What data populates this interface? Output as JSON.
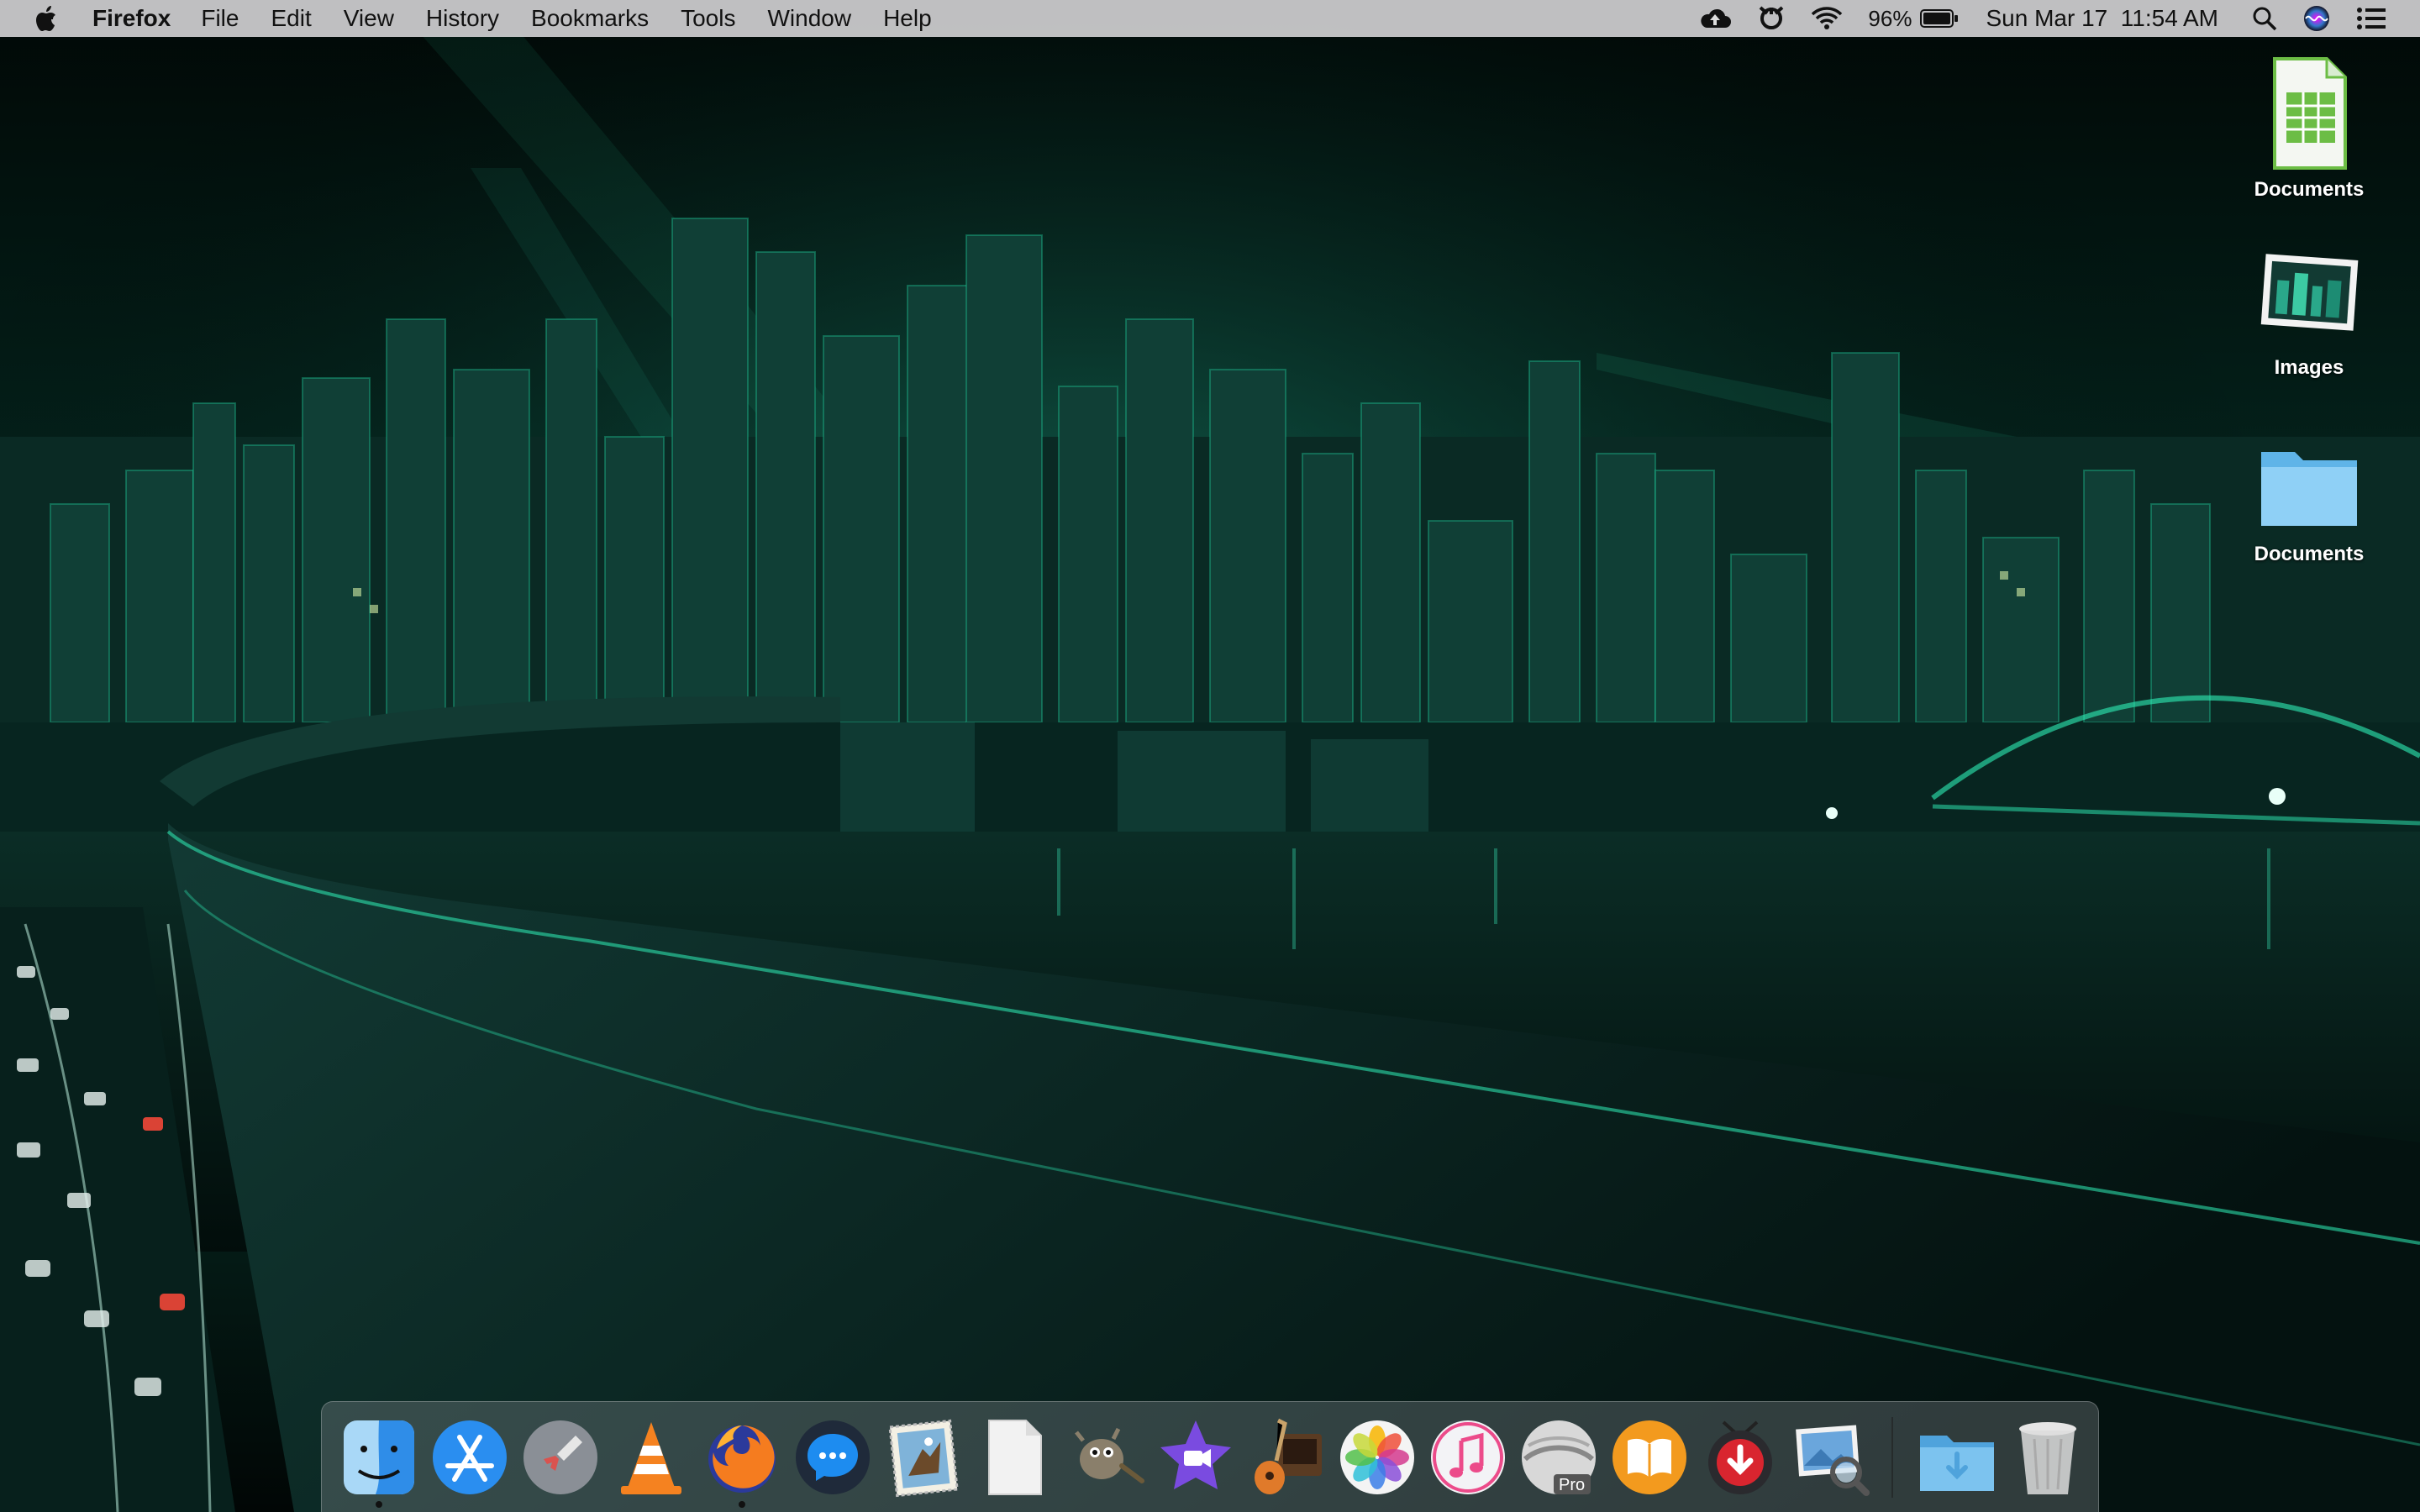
{
  "menubar": {
    "app_name": "Firefox",
    "menus": [
      "File",
      "Edit",
      "View",
      "History",
      "Bookmarks",
      "Tools",
      "Window",
      "Help"
    ],
    "battery_percent": "96%",
    "datetime": "Sun Mar 17  11:54 AM",
    "status_icons": [
      "apple-icon",
      "cloud-upload-icon",
      "avast-icon",
      "wifi-icon",
      "battery-icon",
      "spotlight-search-icon",
      "siri-icon",
      "notification-center-icon"
    ]
  },
  "desktop": {
    "icons": [
      {
        "label": "Documents",
        "icon": "spreadsheet-file-icon"
      },
      {
        "label": "Images",
        "icon": "image-file-icon"
      },
      {
        "label": "Documents",
        "icon": "folder-icon"
      }
    ]
  },
  "dock": {
    "apps": [
      {
        "name": "Finder",
        "icon": "finder-icon",
        "running": true
      },
      {
        "name": "App Store",
        "icon": "app-store-icon",
        "running": false
      },
      {
        "name": "Launchpad",
        "icon": "launchpad-icon",
        "running": false
      },
      {
        "name": "VLC",
        "icon": "vlc-icon",
        "running": false
      },
      {
        "name": "Firefox",
        "icon": "firefox-icon",
        "running": true
      },
      {
        "name": "Messenger",
        "icon": "messenger-icon",
        "running": false
      },
      {
        "name": "Mail",
        "icon": "mail-stamp-icon",
        "running": false
      },
      {
        "name": "TextEdit",
        "icon": "blank-document-icon",
        "running": false
      },
      {
        "name": "GIMP",
        "icon": "gimp-icon",
        "running": false
      },
      {
        "name": "iMovie",
        "icon": "imovie-star-icon",
        "running": false
      },
      {
        "name": "GarageBand",
        "icon": "garageband-guitar-icon",
        "running": false
      },
      {
        "name": "Photos",
        "icon": "photos-icon",
        "running": false
      },
      {
        "name": "iTunes",
        "icon": "itunes-icon",
        "running": false
      },
      {
        "name": "Google Earth Pro",
        "icon": "google-earth-pro-icon",
        "running": false,
        "badge": "Pro"
      },
      {
        "name": "Books",
        "icon": "books-icon",
        "running": false
      },
      {
        "name": "Downie",
        "icon": "downie-icon",
        "running": false
      },
      {
        "name": "Preview",
        "icon": "preview-icon",
        "running": false
      },
      {
        "name": "Downloads",
        "icon": "downloads-folder-icon",
        "running": false
      },
      {
        "name": "Trash",
        "icon": "trash-icon",
        "running": false
      }
    ]
  },
  "colors": {
    "accent_green": "#27e0a8",
    "sky_dark": "#031512",
    "menubar_bg": "#cdcdd0"
  }
}
